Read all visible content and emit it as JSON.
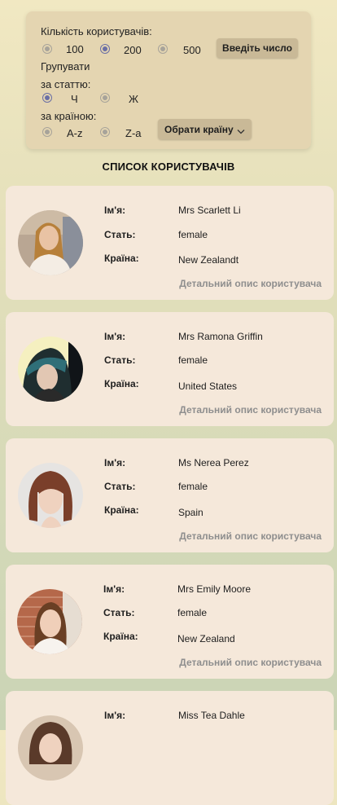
{
  "filters": {
    "user_count_label": "Кількість користувачів:",
    "count_options": [
      "100",
      "200",
      "500"
    ],
    "count_selected": "200",
    "enter_number_button": "Введіть число",
    "group_label": "Групувати",
    "by_gender_label": "за статтю:",
    "gender_options": [
      "Ч",
      "Ж"
    ],
    "gender_selected": "Ч",
    "by_country_label": "за країною:",
    "country_sort_options": [
      "A-z",
      "Z-a"
    ],
    "choose_country_button": "Обрати країну"
  },
  "list_title": "СПИСОК КОРИСТУВАЧІВ",
  "field_labels": {
    "name": "Ім'я:",
    "gender": "Стать:",
    "country": "Країна:"
  },
  "detail_link": "Детальний опис користувача",
  "users": [
    {
      "name": "Mrs Scarlett Li",
      "gender": "female",
      "country": "New Zealandt"
    },
    {
      "name": "Mrs Ramona Griffin",
      "gender": "female",
      "country": "United States"
    },
    {
      "name": "Ms Nerea Perez",
      "gender": "female",
      "country": "Spain"
    },
    {
      "name": "Mrs Emily Moore",
      "gender": "female",
      "country": "New Zealand"
    },
    {
      "name": "Miss Tea Dahle"
    }
  ]
}
